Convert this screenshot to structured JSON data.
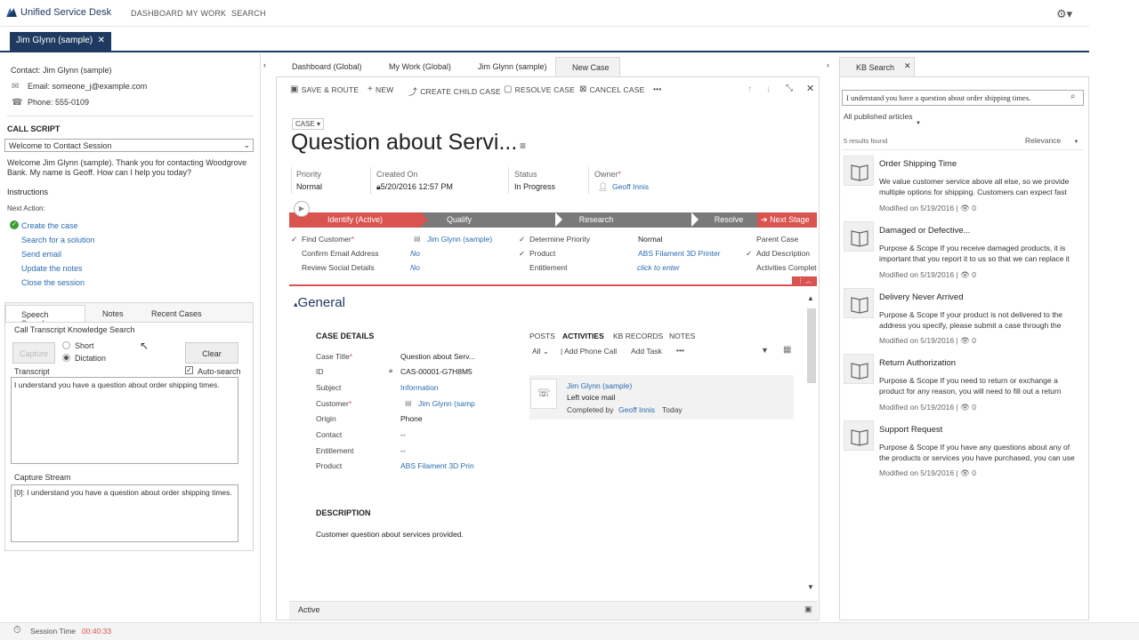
{
  "app": {
    "title": "Unified Service Desk"
  },
  "nav": [
    "DASHBOARD",
    "MY WORK",
    "SEARCH"
  ],
  "session": {
    "tab_label": "Jim Glynn (sample)"
  },
  "contact": {
    "line": "Contact: Jim Glynn (sample)",
    "email": "Email: someone_j@example.com",
    "phone": "Phone: 555-0109"
  },
  "call_script": {
    "title": "CALL SCRIPT",
    "selected": "Welcome to Contact Session",
    "text": "Welcome Jim Glynn (sample). Thank you for contacting Woodgrove Bank. My name is Geoff. How can I help you today?",
    "instructions": "Instructions",
    "next_action": "Next Action:",
    "actions": [
      "Create the case",
      "Search for a solution",
      "Send email",
      "Update the notes",
      "Close the session"
    ]
  },
  "lower_tabs": [
    "Speech Search",
    "Notes",
    "Recent Cases"
  ],
  "speech": {
    "heading": "Call Transcript Knowledge Search",
    "capture_btn": "Capture",
    "mode_short": "Short",
    "mode_dictation": "Dictation",
    "clear_btn": "Clear",
    "transcript_label": "Transcript",
    "auto_search": "Auto-search",
    "transcript_text": "I understand you have a question about order shipping times.",
    "capture_label": "Capture Stream",
    "capture_text": "[0]: I understand you have a question about order shipping times."
  },
  "main_tabs": [
    "Dashboard (Global)",
    "My Work (Global)",
    "Jim Glynn (sample)",
    "New Case"
  ],
  "commands": [
    "SAVE & ROUTE",
    "NEW",
    "CREATE CHILD CASE",
    "RESOLVE CASE",
    "CANCEL CASE",
    "•••"
  ],
  "case": {
    "entity": "CASE",
    "title": "Question about Servi...",
    "priority_label": "Priority",
    "priority": "Normal",
    "created_label": "Created On",
    "created": "5/20/2016    12:57 PM",
    "status_label": "Status",
    "status": "In Progress",
    "owner_label": "Owner",
    "owner": "Geoff Innis"
  },
  "process": {
    "stages": [
      "Identify (Active)",
      "Qualify",
      "Research",
      "Resolve"
    ],
    "next": "Next Stage",
    "col1": [
      {
        "label": "Find Customer",
        "value": "Jim Glynn (sample)"
      },
      {
        "label": "Confirm Email Address",
        "value": "No"
      },
      {
        "label": "Review Social Details",
        "value": "No"
      }
    ],
    "col2": [
      {
        "label": "Determine Priority",
        "value": "Normal"
      },
      {
        "label": "Product",
        "value": "ABS Filament 3D Printer"
      },
      {
        "label": "Entitlement",
        "value": "click to enter"
      }
    ],
    "col3": [
      "Parent Case",
      "Add Description",
      "Activities Complete"
    ]
  },
  "general": {
    "title": "General",
    "case_details": "CASE DETAILS",
    "fields": [
      {
        "label": "Case Title",
        "value": "Question about Serv..."
      },
      {
        "label": "ID",
        "value": "CAS-00001-G7H8M5"
      },
      {
        "label": "Subject",
        "value": "Information"
      },
      {
        "label": "Customer",
        "value": "Jim Glynn (samp"
      },
      {
        "label": "Origin",
        "value": "Phone"
      },
      {
        "label": "Contact",
        "value": "--"
      },
      {
        "label": "Entitlement",
        "value": "--"
      },
      {
        "label": "Product",
        "value": "ABS Filament 3D Prin"
      }
    ],
    "description_label": "DESCRIPTION",
    "description": "Customer question about services provided."
  },
  "social": {
    "tabs": [
      "POSTS",
      "ACTIVITIES",
      "KB RECORDS",
      "NOTES"
    ],
    "filter": "All",
    "add_phone": "| Add Phone Call",
    "add_task": "Add Task",
    "more": "•••",
    "activity": {
      "name": "Jim Glynn (sample)",
      "subject": "Left voice mail",
      "completed_by": "Completed by",
      "who": "Geoff Innis",
      "when": "Today"
    }
  },
  "status_bar": {
    "state": "Active"
  },
  "kb": {
    "tab": "KB Search",
    "query": "I understand you have a question about order shipping times.",
    "scope": "All published articles",
    "count": "5 results found",
    "sort": "Relevance",
    "articles": [
      {
        "title": "Order Shipping Time",
        "desc": "We value customer service above all else, so we provide multiple options for shipping. Customers can expect fast",
        "modified": "Modified on 5/19/2016",
        "views": "0"
      },
      {
        "title": "Damaged or Defective...",
        "desc": "Purpose & Scope If you receive damaged products, it is important that you report it to us so that we can replace it",
        "modified": "Modified on 5/19/2016",
        "views": "0"
      },
      {
        "title": "Delivery Never Arrived",
        "desc": "Purpose & Scope If your product is not delivered to the address you specify, please submit a case through the",
        "modified": "Modified on 5/19/2016",
        "views": "0"
      },
      {
        "title": "Return Authorization",
        "desc": "Purpose & Scope If you need to return or exchange a product for any reason, you will need to fill out a return",
        "modified": "Modified on 5/19/2016",
        "views": "0"
      },
      {
        "title": "Support Request",
        "desc": "Purpose & Scope If you have any questions about any of the products or services you have purchased, you can use",
        "modified": "Modified on 5/19/2016",
        "views": "0"
      }
    ]
  },
  "footer": {
    "label": "Session Time",
    "time": "00:40:33"
  },
  "colors": {
    "brand": "#1f3a60",
    "accent": "#d9534f",
    "link": "#2b6cb0"
  }
}
